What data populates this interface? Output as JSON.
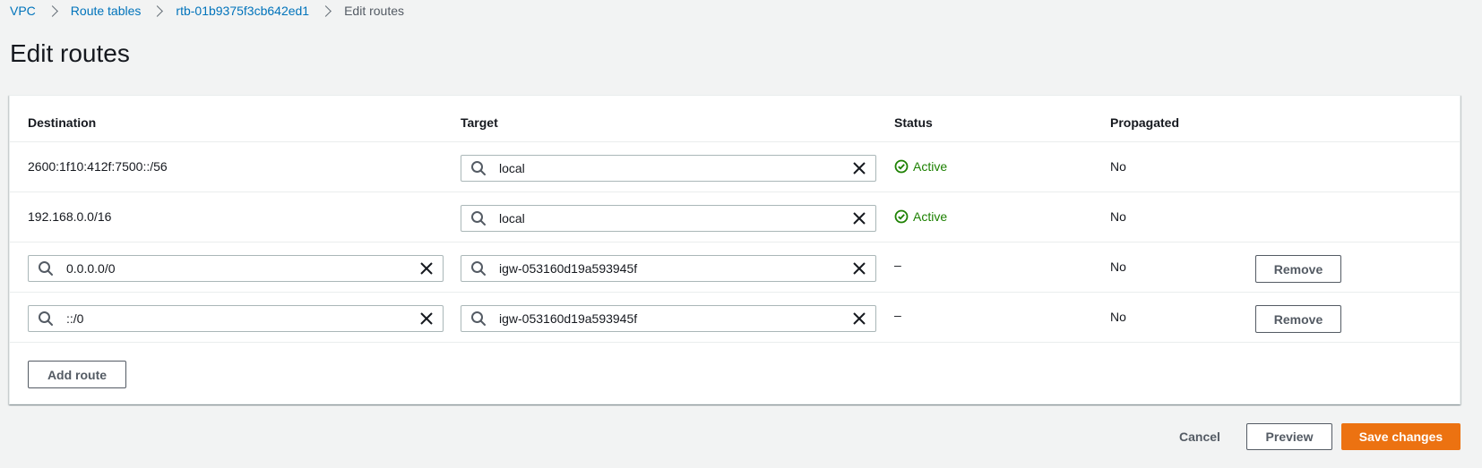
{
  "breadcrumb": {
    "items": [
      "VPC",
      "Route tables",
      "rtb-01b9375f3cb642ed1"
    ],
    "current": "Edit routes"
  },
  "page": {
    "title": "Edit routes"
  },
  "table": {
    "columns": [
      "Destination",
      "Target",
      "Status",
      "Propagated"
    ],
    "rows": [
      {
        "destination": "2600:1f10:412f:7500::/56",
        "target": "local",
        "status": "Active",
        "propagated": "No"
      },
      {
        "destination": "192.168.0.0/16",
        "target": "local",
        "status": "Active",
        "propagated": "No"
      },
      {
        "destination": "0.0.0.0/0",
        "target": "igw-053160d19a593945f",
        "status": "–",
        "propagated": "No",
        "remove_label": "Remove"
      },
      {
        "destination": "::/0",
        "target": "igw-053160d19a593945f",
        "status": "–",
        "propagated": "No",
        "remove_label": "Remove"
      }
    ],
    "add_route_label": "Add route"
  },
  "footer": {
    "cancel_label": "Cancel",
    "preview_label": "Preview",
    "save_label": "Save changes"
  },
  "colors": {
    "link": "#0073bb",
    "active": "#1d8102",
    "primary": "#ec7211",
    "background": "#f2f3f3"
  },
  "icons": {
    "search": "search-icon",
    "clear": "close-icon",
    "status": "check-circle-icon",
    "breadcrumb_separator": "chevron-right-icon"
  }
}
